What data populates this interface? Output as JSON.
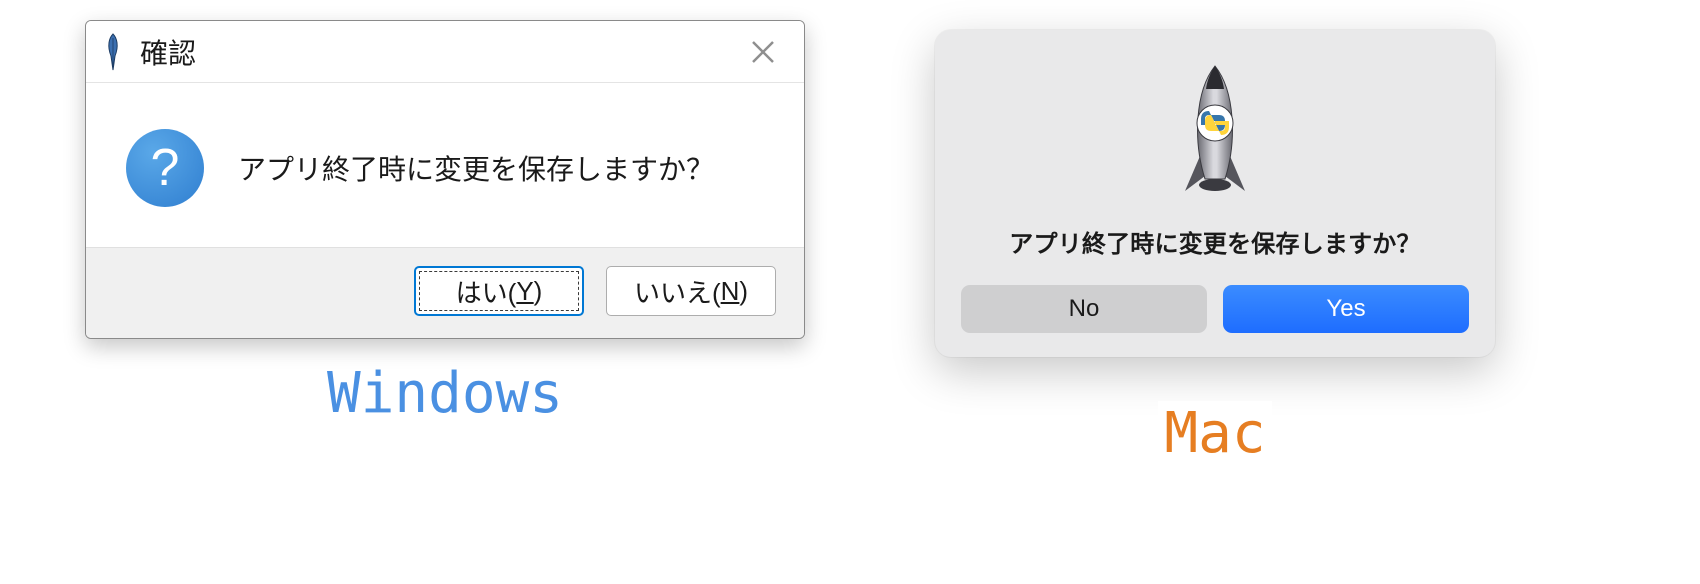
{
  "windows": {
    "title": "確認",
    "message": "アプリ終了時に変更を保存しますか？",
    "yes_pre": "はい(",
    "yes_mnem": "Y",
    "yes_post": ")",
    "no_pre": "いいえ(",
    "no_mnem": "N",
    "no_post": ")",
    "close_glyph": "×",
    "caption": "Windows"
  },
  "mac": {
    "message": "アプリ終了時に変更を保存しますか？",
    "no_label": "No",
    "yes_label": "Yes",
    "caption": "Mac"
  },
  "icons": {
    "question": "?"
  }
}
